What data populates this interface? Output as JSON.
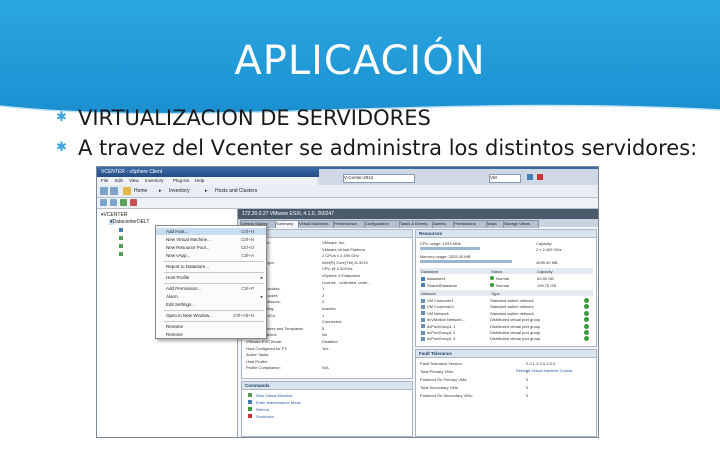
{
  "slide": {
    "title": "APLICACIÓN",
    "bullets": [
      "VIRTUALIZACION DE SERVIDORES",
      "A travez del Vcenter se administra los distintos servidores:"
    ],
    "accent": "#1b8fd0"
  },
  "window": {
    "title": "VCENTER - vSphere Client",
    "search_label": "V-Center-2012",
    "vm_label": "VM",
    "menu": [
      "File",
      "Edit",
      "View",
      "Inventory",
      "Plug-ins",
      "Help"
    ],
    "nav": {
      "home": "Home",
      "inventory": "Inventory",
      "hosts": "Hosts and Clusters"
    }
  },
  "tree": {
    "root": "VCENTER",
    "datacenter": "DatacenterDELT"
  },
  "context_menu": {
    "items": [
      {
        "label": "Add Host...",
        "key": "Ctrl+H"
      },
      {
        "label": "New Virtual Machine...",
        "key": "Ctrl+N"
      },
      {
        "label": "New Resource Pool...",
        "key": "Ctrl+O"
      },
      {
        "label": "New vApp...",
        "key": "Ctrl+A"
      },
      {
        "label": "Report to Datastore...",
        "key": ""
      },
      {
        "label": "Host Profile",
        "key": ""
      },
      {
        "label": "Add Permission...",
        "key": "Ctrl+P"
      },
      {
        "label": "Alarm",
        "key": ""
      },
      {
        "label": "Edit Settings...",
        "key": ""
      },
      {
        "label": "Open in New Window...",
        "key": "Ctrl+Alt+N"
      },
      {
        "label": "Rename",
        "key": ""
      },
      {
        "label": "Remove",
        "key": ""
      }
    ]
  },
  "main": {
    "header": "172.20.0.27 VMware ESXi, 4.1.0, 260247",
    "tabs": [
      "Getting Started",
      "Summary",
      "Virtual Machines",
      "Performance",
      "Configuration",
      "Tasks & Events",
      "Alarms",
      "Permissions",
      "Maps",
      "Storage Views"
    ],
    "general": {
      "title": "General",
      "rows": [
        {
          "k": "Manufacturer:",
          "v": "VMware, Inc."
        },
        {
          "k": "Model:",
          "v": "VMware Virtual Platform"
        },
        {
          "k": "CPU Cores:",
          "v": "2 CPUs x 2.499 GHz"
        },
        {
          "k": "Processor Type:",
          "v": "Intel(R) Core(TM) i5-3210"
        },
        {
          "k": "",
          "v": "CPU @ 2.50GHz"
        },
        {
          "k": "License:",
          "v": "vSphere 4 Evaluation"
        },
        {
          "k": "",
          "v": "License - Unlimited, unde..."
        },
        {
          "k": "Processor Sockets:",
          "v": "1"
        },
        {
          "k": "Cores per Socket:",
          "v": "2"
        },
        {
          "k": "Logical Processors:",
          "v": "2"
        },
        {
          "k": "Hyperthreading:",
          "v": "Inactive"
        },
        {
          "k": "Number of NICs:",
          "v": "1"
        },
        {
          "k": "State:",
          "v": "Connected"
        },
        {
          "k": "Virtual Machines and Templates:",
          "v": "5"
        },
        {
          "k": "vMotion Enabled:",
          "v": "No"
        },
        {
          "k": "VMware EVC Mode:",
          "v": "Disabled"
        },
        {
          "k": "Host Configured for FT:",
          "v": "Yes"
        },
        {
          "k": "Active Tasks:",
          "v": ""
        },
        {
          "k": "Host Profile:",
          "v": ""
        },
        {
          "k": "Profile Compliance:",
          "v": "N/A"
        }
      ]
    },
    "commands": {
      "title": "Commands",
      "items": [
        "New Virtual Machine",
        "Enter Maintenance Mode",
        "Reboot",
        "Shutdown"
      ]
    },
    "resources": {
      "title": "Resources",
      "cpu_label": "CPU usage: 1293 MHz",
      "cpu_capacity": "2 x 2.499 GHz",
      "mem_label": "Memory usage: 3325.00 MB",
      "mem_capacity": "4095.49 MB",
      "capacity_header": "Capacity",
      "ds_headers": [
        "Datastore",
        "Status",
        "Capacity"
      ],
      "datastores": [
        {
          "name": "datastore1",
          "status": "Normal",
          "cap": "52.50 GB"
        },
        {
          "name": "SharedDatastore",
          "status": "Normal",
          "cap": "199.75 GB"
        }
      ],
      "net_headers": [
        "Network",
        "Type"
      ],
      "networks": [
        {
          "name": "VM Customer1",
          "type": "Standard switch network"
        },
        {
          "name": "VM Customer2",
          "type": "Standard switch network"
        },
        {
          "name": "VM Network",
          "type": "Standard switch network"
        },
        {
          "name": "dvVMotion Network...",
          "type": "Distributed virtual port group"
        },
        {
          "name": "dvPortGroup1 1",
          "type": "Distributed virtual port group"
        },
        {
          "name": "dvPortGroup1 2",
          "type": "Distributed virtual port group"
        },
        {
          "name": "dvPortGroup1 3",
          "type": "Distributed virtual port group"
        }
      ]
    },
    "ft": {
      "title": "Fault Tolerance",
      "version": "2.0.1-2.0.0-2.0.0",
      "link": "Refresh Virtual Machine Counts",
      "rows": [
        {
          "k": "Fault Tolerance Version:",
          "v": ""
        },
        {
          "k": "Total Primary VMs:",
          "v": "2"
        },
        {
          "k": "Powered On Primary VMs:",
          "v": "0"
        },
        {
          "k": "Total Secondary VMs:",
          "v": "0"
        },
        {
          "k": "Powered On Secondary VMs:",
          "v": "0"
        }
      ]
    }
  }
}
